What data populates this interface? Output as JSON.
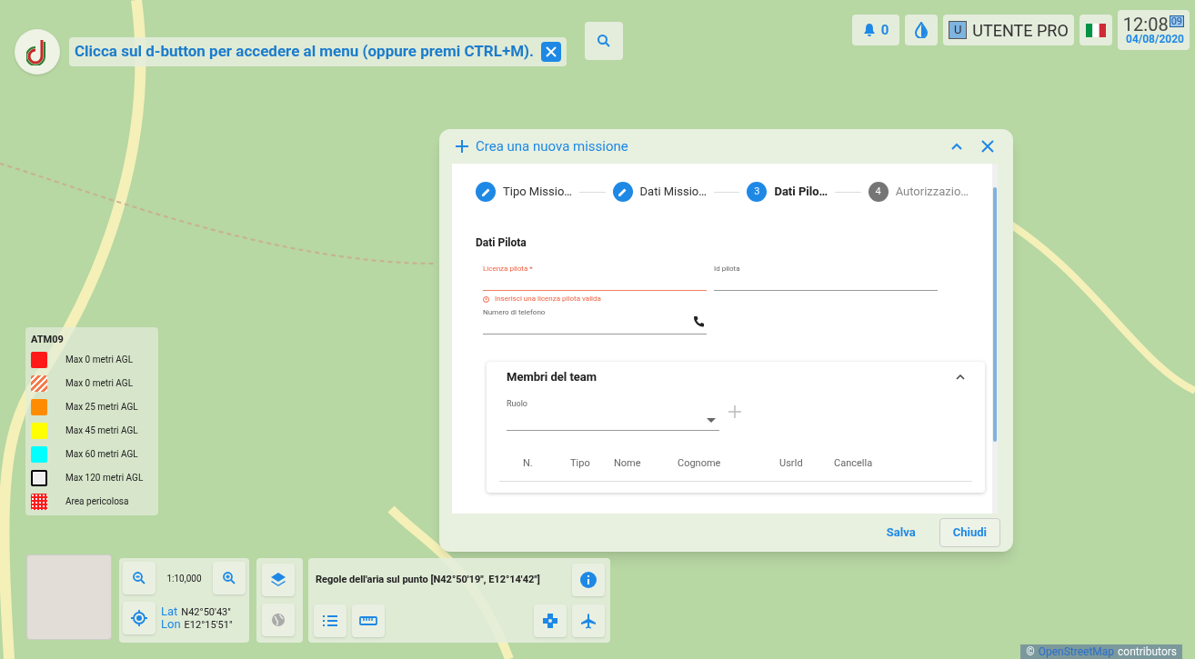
{
  "hint_bar": {
    "text": "Clicca sul d-button per accedere al menu (oppure premi CTRL+M)."
  },
  "top_right": {
    "notifications": "0",
    "user_initial": "U",
    "user": "UTENTE PRO",
    "time": "12:08",
    "seconds": "09",
    "date": "04/08/2020"
  },
  "legend": {
    "title": "ATM09",
    "items": [
      {
        "kind": "solid",
        "color": "#ff1a1a",
        "label": "Max 0 metri AGL"
      },
      {
        "kind": "hatched",
        "color": "#f47a4a",
        "label": "Max 0 metri AGL"
      },
      {
        "kind": "solid",
        "color": "#ff8c00",
        "label": "Max 25 metri AGL"
      },
      {
        "kind": "solid",
        "color": "#ffff00",
        "label": "Max 45 metri AGL"
      },
      {
        "kind": "solid",
        "color": "#00ffff",
        "label": "Max 60 metri AGL"
      },
      {
        "kind": "outline",
        "color": "#000000",
        "label": "Max 120 metri AGL"
      },
      {
        "kind": "dotted",
        "color": "#ff1a1a",
        "label": "Area pericolosa"
      }
    ]
  },
  "dialog": {
    "title": "Crea una nuova missione",
    "steps": [
      {
        "label": "Tipo Missio…",
        "completed": true,
        "selected": false
      },
      {
        "label": "Dati Missio…",
        "completed": true,
        "selected": false
      },
      {
        "label": "Dati Pilo…",
        "number": "3",
        "completed": false,
        "selected": true
      },
      {
        "label": "Autorizzazio…",
        "number": "4",
        "completed": false,
        "selected": false
      }
    ],
    "section_title": "Dati Pilota",
    "fields": [
      {
        "kind": "text",
        "label": "Licenza pilota *",
        "error": "Inserisci una licenza pilota valida"
      },
      {
        "kind": "text",
        "label": "Id pilota"
      },
      {
        "kind": "phone",
        "label": "Numero di telefono"
      }
    ],
    "team": {
      "title": "Membri del team",
      "expanded": true,
      "role_label": "Ruolo",
      "columns": [
        "N.",
        "Tipo",
        "Nome",
        "Cognome",
        "UsrId",
        "Cancella"
      ]
    },
    "buttons": [
      {
        "label": "Salva",
        "outlined": false
      },
      {
        "label": "Chiudi",
        "outlined": true
      }
    ]
  },
  "map_controls": {
    "scale": "1:10,000",
    "lat_label": "Lat",
    "lat": "N42°50'43\"",
    "lon_label": "Lon",
    "lon": "E12°15'51\"",
    "rules": "Regole dell'aria sul punto [N42°50'19\", E12°14'42\"]"
  },
  "attribution": {
    "symbol": "©",
    "link": "OpenStreetMap",
    "text": "contributors"
  }
}
